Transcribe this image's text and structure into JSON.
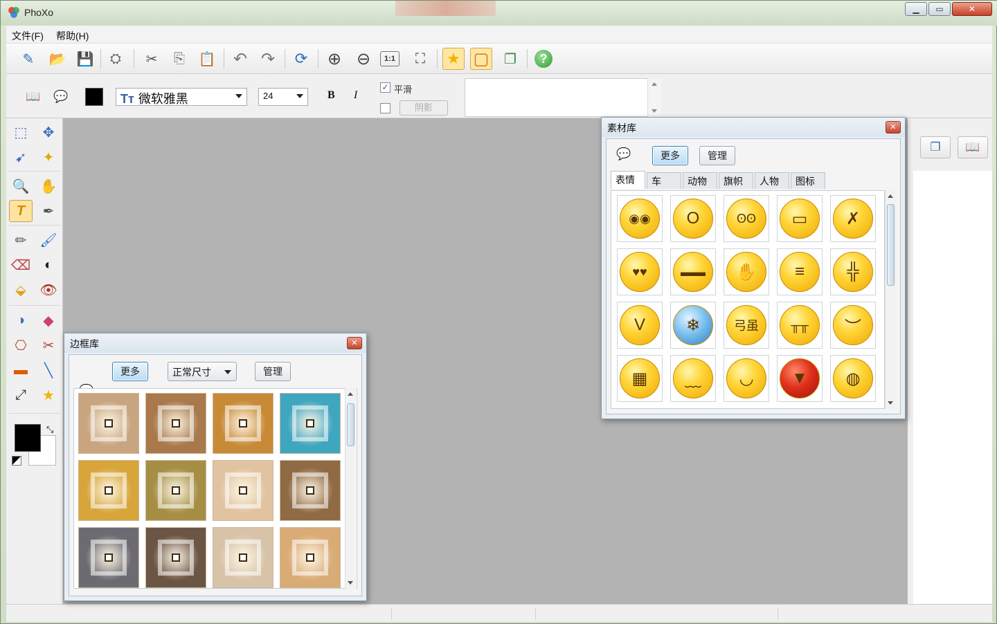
{
  "app": {
    "title": "PhoXo"
  },
  "window_buttons": {
    "minimize": "▁",
    "maximize": "▭",
    "close": "✕"
  },
  "menu": {
    "items": [
      {
        "label": "文件(F)"
      },
      {
        "label": "帮助(H)"
      }
    ]
  },
  "toolbar": {
    "buttons": [
      {
        "name": "new-icon",
        "glyph": "✎"
      },
      {
        "name": "open-folder-icon",
        "glyph": "📂"
      },
      {
        "name": "save-icon",
        "glyph": "💾"
      },
      {
        "name": "batch-icon",
        "glyph": "⛭"
      },
      {
        "name": "cut-icon",
        "glyph": "✂"
      },
      {
        "name": "copy-icon",
        "glyph": "⎘"
      },
      {
        "name": "paste-icon",
        "glyph": "📋"
      },
      {
        "name": "undo-icon",
        "glyph": "↶"
      },
      {
        "name": "redo-icon",
        "glyph": "↷"
      },
      {
        "name": "refresh-icon",
        "glyph": "⟳"
      },
      {
        "name": "zoom-in-icon",
        "glyph": "⊕"
      },
      {
        "name": "zoom-out-icon",
        "glyph": "⊖"
      },
      {
        "name": "actual-size-icon",
        "glyph": "1:1"
      },
      {
        "name": "fit-window-icon",
        "glyph": "⛶"
      },
      {
        "name": "material-library-icon",
        "glyph": "★"
      },
      {
        "name": "frame-library-icon",
        "glyph": "▢"
      },
      {
        "name": "image-stack-icon",
        "glyph": "❐"
      },
      {
        "name": "help-icon",
        "glyph": "?"
      }
    ]
  },
  "textbar": {
    "book_icon": "📖",
    "bubble_icon": "💬",
    "text_color": "#000000",
    "font_name": "微软雅黑",
    "font_icon": "Tт",
    "font_size": "24",
    "bold_label": "B",
    "italic_label": "I",
    "smooth_label": "平滑",
    "smooth_checked": "✓",
    "shadow_label": "阴影"
  },
  "tools": [
    {
      "name": "rect-select-icon",
      "glyph": "⬚"
    },
    {
      "name": "move-icon",
      "glyph": "✥"
    },
    {
      "name": "lasso-select-icon",
      "glyph": "➹"
    },
    {
      "name": "magic-wand-icon",
      "glyph": "✦"
    },
    {
      "name": "zoom-icon",
      "glyph": "🔍"
    },
    {
      "name": "hand-icon",
      "glyph": "✋"
    },
    {
      "name": "text-tool-icon",
      "glyph": "T"
    },
    {
      "name": "eyedropper-icon",
      "glyph": "✒"
    },
    {
      "name": "pencil-icon",
      "glyph": "✏"
    },
    {
      "name": "brush-icon",
      "glyph": "🖌"
    },
    {
      "name": "eraser-icon",
      "glyph": "⌫"
    },
    {
      "name": "contrast-icon",
      "glyph": "◐"
    },
    {
      "name": "fill-icon",
      "glyph": "⬙"
    },
    {
      "name": "red-eye-icon",
      "glyph": "👁"
    },
    {
      "name": "dodge-icon",
      "glyph": "◑"
    },
    {
      "name": "color-replace-icon",
      "glyph": "◆"
    },
    {
      "name": "stamp-icon",
      "glyph": "⎔"
    },
    {
      "name": "heal-icon",
      "glyph": "✂"
    },
    {
      "name": "gradient-icon",
      "glyph": "▬"
    },
    {
      "name": "line-icon",
      "glyph": "╲"
    },
    {
      "name": "transform-icon",
      "glyph": "⤢"
    },
    {
      "name": "star-shape-icon",
      "glyph": "★"
    }
  ],
  "colors": {
    "foreground": "#000000",
    "background": "#ffffff"
  },
  "material_library": {
    "title": "素材库",
    "more_label": "更多",
    "manage_label": "管理",
    "tabs": [
      {
        "label": "表情",
        "active": true
      },
      {
        "label": "车"
      },
      {
        "label": "动物"
      },
      {
        "label": "旗帜"
      },
      {
        "label": "人物"
      },
      {
        "label": "图标"
      }
    ],
    "emojis": [
      {
        "name": "emoji-shy",
        "glyph": "◉◉"
      },
      {
        "name": "emoji-yawn",
        "glyph": "O"
      },
      {
        "name": "emoji-dizzy",
        "glyph": "ʘʘ"
      },
      {
        "name": "emoji-bandaged",
        "glyph": "▭"
      },
      {
        "name": "emoji-stunned",
        "glyph": "✗"
      },
      {
        "name": "emoji-love",
        "glyph": "♥♥"
      },
      {
        "name": "emoji-cool",
        "glyph": "▬▬"
      },
      {
        "name": "emoji-slap",
        "glyph": "✋"
      },
      {
        "name": "emoji-grin",
        "glyph": "≡"
      },
      {
        "name": "emoji-annoyed",
        "glyph": "╬"
      },
      {
        "name": "emoji-angry",
        "glyph": "V"
      },
      {
        "name": "emoji-cold",
        "glyph": "❄"
      },
      {
        "name": "emoji-weak",
        "glyph": "弓虽"
      },
      {
        "name": "emoji-cry",
        "glyph": "╥╥"
      },
      {
        "name": "emoji-sad",
        "glyph": "︶"
      },
      {
        "name": "emoji-scared",
        "glyph": "▦"
      },
      {
        "name": "emoji-sweat",
        "glyph": "﹏"
      },
      {
        "name": "emoji-happy",
        "glyph": "◡"
      },
      {
        "name": "emoji-devil",
        "glyph": "▼"
      },
      {
        "name": "emoji-eating",
        "glyph": "◍"
      }
    ]
  },
  "frame_library": {
    "title": "边框库",
    "more_label": "更多",
    "size_label": "正常尺寸",
    "manage_label": "管理",
    "frames": [
      {
        "name": "frame-beige-wood",
        "color": "#c8a47f"
      },
      {
        "name": "frame-brown-wood",
        "color": "#a9794b"
      },
      {
        "name": "frame-golden-glow",
        "color": "#c88a36"
      },
      {
        "name": "frame-teal-pattern",
        "color": "#3fa6bf"
      },
      {
        "name": "frame-gold-ornate",
        "color": "#d7a53a"
      },
      {
        "name": "frame-olive-gold",
        "color": "#a68f45"
      },
      {
        "name": "frame-lace-pattern",
        "color": "#e0c3a0"
      },
      {
        "name": "frame-zebra-wood",
        "color": "#8f6a44"
      },
      {
        "name": "frame-grey-metal",
        "color": "#6d6b72"
      },
      {
        "name": "frame-dark-oak",
        "color": "#6b5544"
      },
      {
        "name": "frame-cream-floral",
        "color": "#d7c4a8"
      },
      {
        "name": "frame-sand-swirl",
        "color": "#d9ab75"
      }
    ]
  },
  "right_panel": {
    "layers_icon": "❐",
    "book_icon": "📖"
  }
}
